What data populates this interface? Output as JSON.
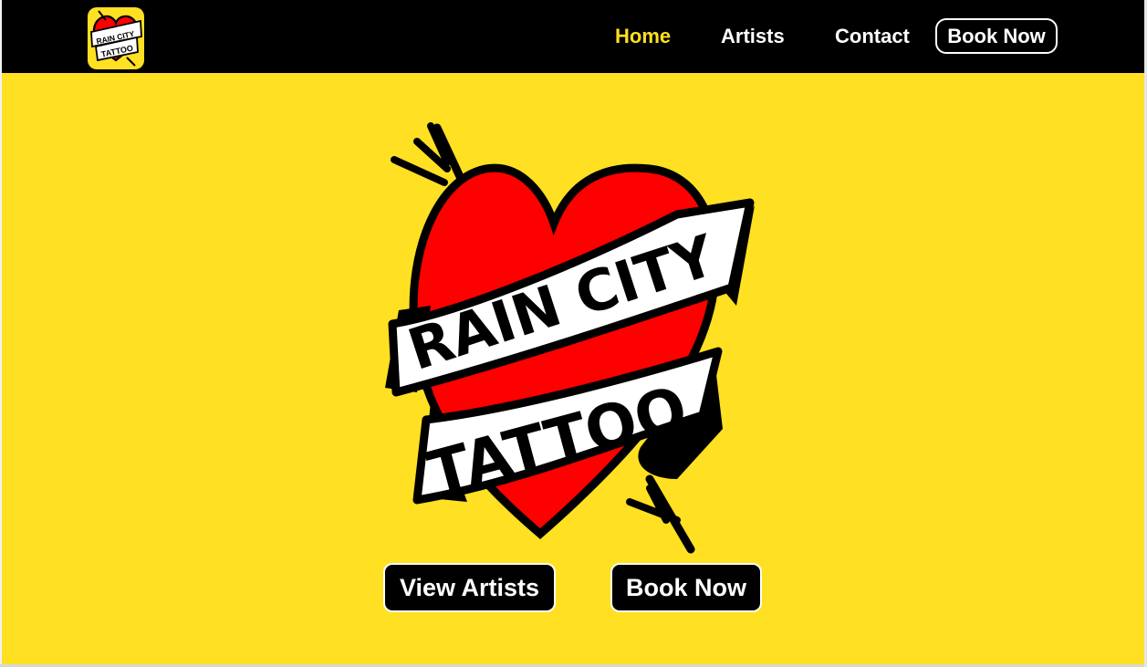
{
  "brand": {
    "logo_text_line1": "RAIN CITY",
    "logo_text_line2": "TATTOO",
    "colors": {
      "yellow": "#ffe022",
      "red": "#ff0000",
      "black": "#000000",
      "white": "#ffffff"
    }
  },
  "nav": {
    "items": [
      {
        "label": "Home",
        "active": true
      },
      {
        "label": "Artists",
        "active": false
      },
      {
        "label": "Contact",
        "active": false
      }
    ],
    "cta_label": "Book Now"
  },
  "hero": {
    "buttons": [
      {
        "label": "View Artists"
      },
      {
        "label": "Book Now"
      }
    ]
  }
}
